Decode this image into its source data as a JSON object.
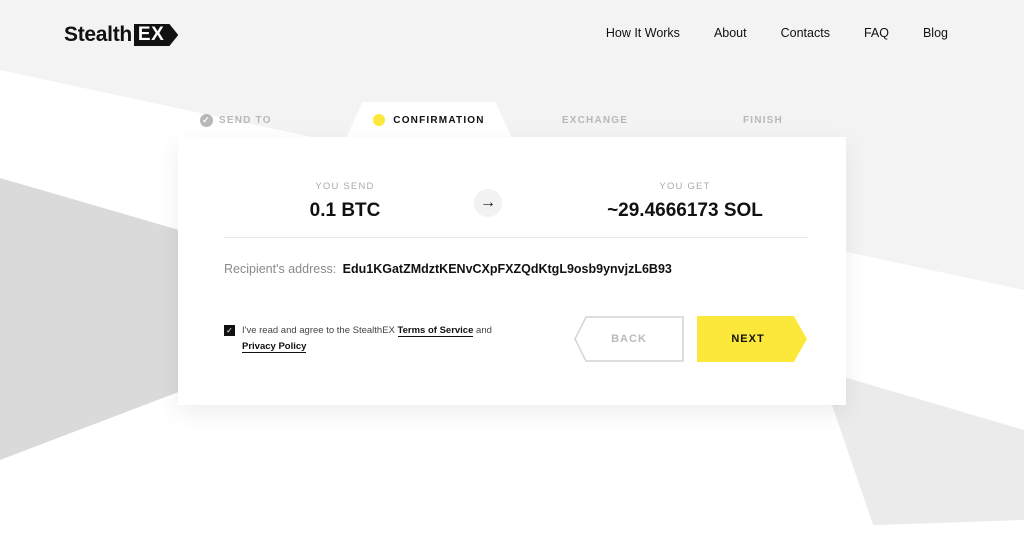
{
  "brand": {
    "name": "Stealth",
    "badge": "EX"
  },
  "nav": [
    {
      "label": "How It Works"
    },
    {
      "label": "About"
    },
    {
      "label": "Contacts"
    },
    {
      "label": "FAQ"
    },
    {
      "label": "Blog"
    }
  ],
  "steps": [
    {
      "label": "SEND TO",
      "state": "done"
    },
    {
      "label": "CONFIRMATION",
      "state": "active"
    },
    {
      "label": "EXCHANGE",
      "state": "pending"
    },
    {
      "label": "FINISH",
      "state": "pending"
    }
  ],
  "exchange": {
    "send_label": "YOU SEND",
    "send_value": "0.1 BTC",
    "get_label": "YOU GET",
    "get_value": "~29.4666173 SOL"
  },
  "recipient": {
    "label": "Recipient's address:",
    "address": "Edu1KGatZMdztKENvCXpFXZQdKtgL9osb9ynvjzL6B93"
  },
  "agreement": {
    "checked": true,
    "prefix": "I've read and agree to the StealthEX ",
    "terms": "Terms of Service",
    "and": " and",
    "privacy": "Privacy Policy"
  },
  "buttons": {
    "back": "BACK",
    "next": "NEXT"
  },
  "colors": {
    "accent": "#fce83a",
    "text": "#111111",
    "muted": "#b8b8b8",
    "background": "#f3f3f3"
  },
  "icons": {
    "step_done": "check-circle-icon",
    "exchange_direction": "arrow-right-icon"
  }
}
